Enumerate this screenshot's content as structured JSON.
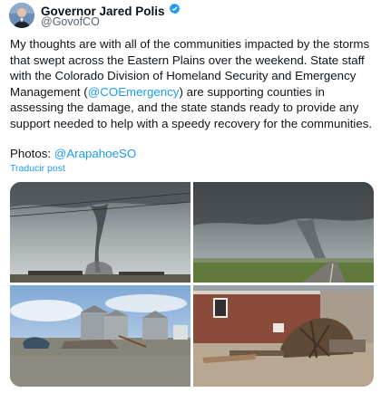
{
  "author": {
    "name": "Governor Jared Polis",
    "handle": "@GovofCO",
    "verified_badge_icon": "verified-badge-icon"
  },
  "post": {
    "text_before_mention": "My thoughts are with all of the communities impacted by the storms that swept across the Eastern Plains over the weekend. State staff with the Colorado Division of Homeland Security and Emergency Management (",
    "mention": "@COEmergency",
    "text_after_mention": ") are supporting counties in assessing the damage, and the state stands ready to provide any support needed to help with a speedy recovery for the communities.",
    "photos_label": "Photos: ",
    "photos_mention": "@ArapahoeSO",
    "translate_label": "Traducir post"
  },
  "colors": {
    "link": "#1d9bf0",
    "secondary_text": "#536471",
    "primary_text": "#0f1419",
    "verified": "#1d9bf0"
  }
}
